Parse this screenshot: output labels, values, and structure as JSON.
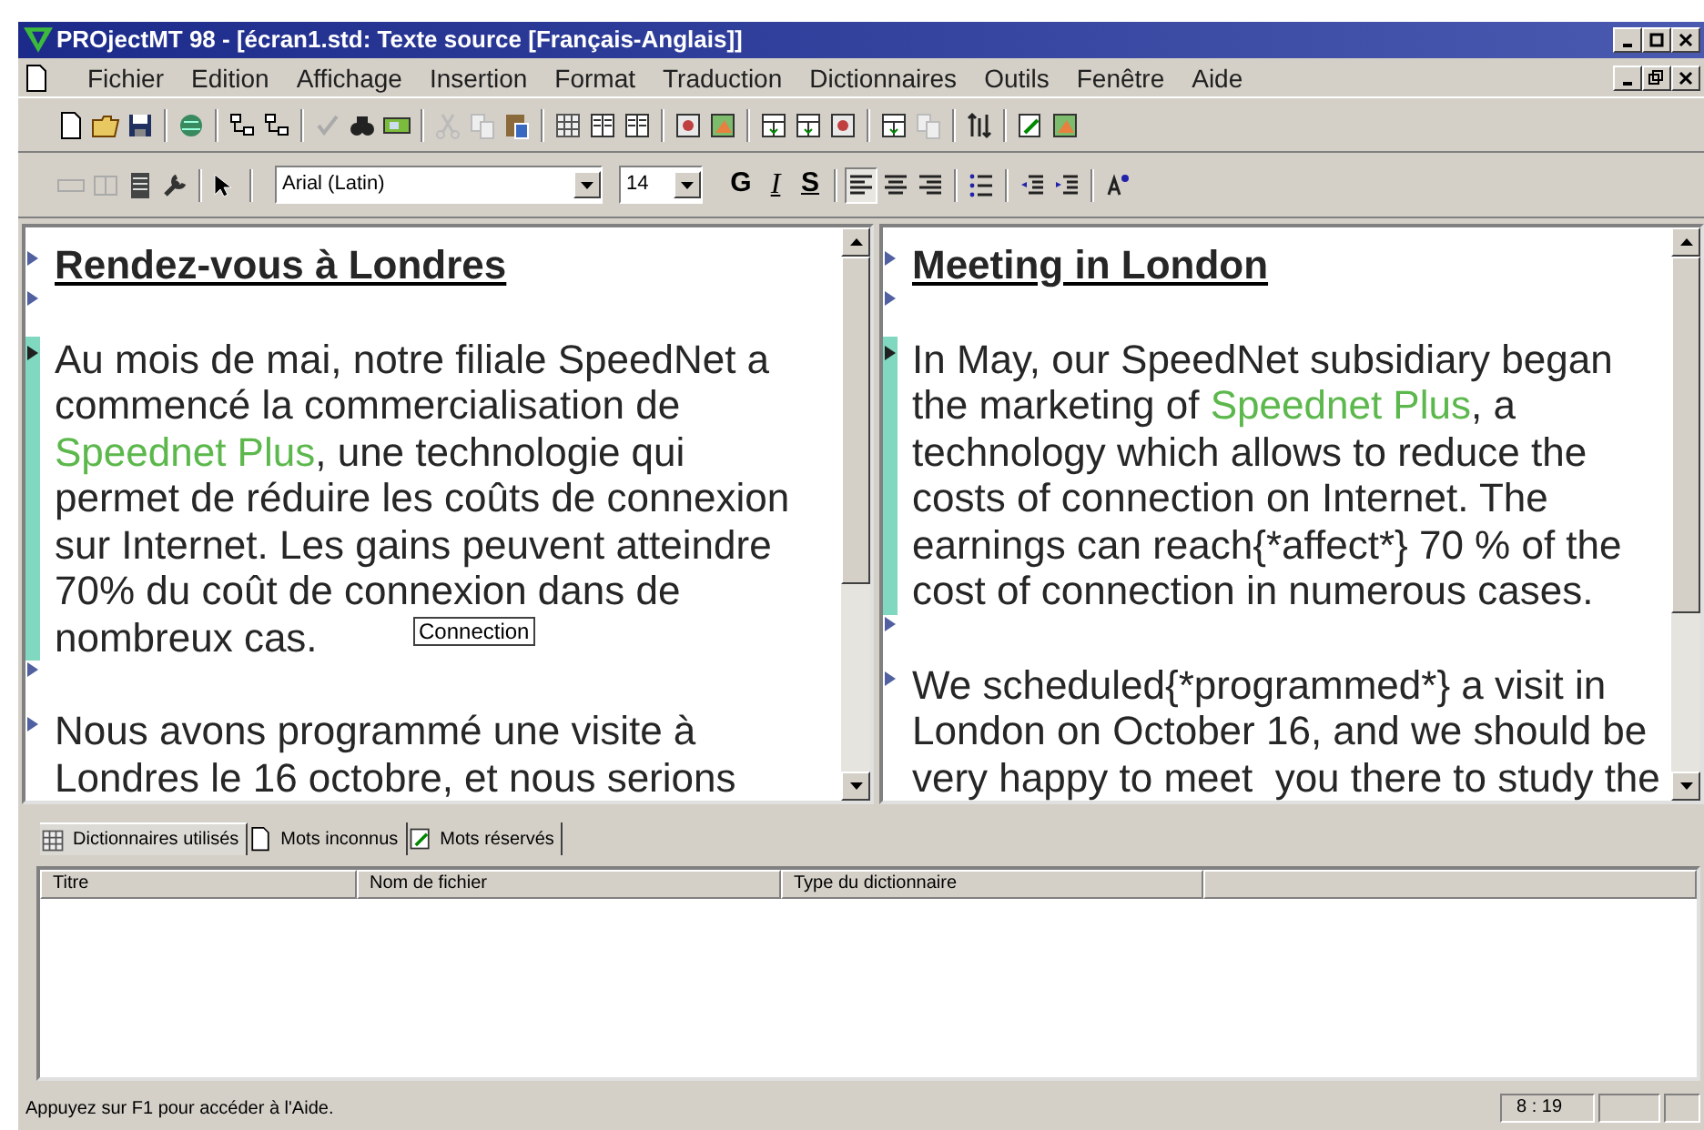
{
  "window": {
    "title": "PROjectMT 98 - [écran1.std: Texte source [Français-Anglais]]"
  },
  "menu": [
    "Fichier",
    "Edition",
    "Affichage",
    "Insertion",
    "Format",
    "Traduction",
    "Dictionnaires",
    "Outils",
    "Fenêtre",
    "Aide"
  ],
  "format_bar": {
    "font": "Arial (Latin)",
    "size": "14",
    "bold_label": "G",
    "italic_label": "I",
    "underline_label": "S"
  },
  "panes": [
    {
      "paragraphs": [
        {
          "kind": "heading",
          "selected": false,
          "lines": [
            [
              {
                "text": "Rendez-vous à Londres",
                "kind": "plain"
              }
            ]
          ]
        },
        {
          "kind": "empty",
          "selected": false
        },
        {
          "kind": "body",
          "selected": true,
          "lines": [
            [
              {
                "text": "Au mois de mai, notre filiale SpeedNet a",
                "kind": "plain"
              }
            ],
            [
              {
                "text": "commencé la commercialisation de",
                "kind": "plain"
              }
            ],
            [
              {
                "text": "Speednet Plus",
                "kind": "term"
              },
              {
                "text": ", une technologie qui",
                "kind": "plain"
              }
            ],
            [
              {
                "text": "permet de réduire les coûts de connexion",
                "kind": "plain"
              }
            ],
            [
              {
                "text": "sur Internet. Les gains peuvent atteindre",
                "kind": "plain"
              }
            ],
            [
              {
                "text": "70% du coût de connexion dans de",
                "kind": "plain"
              }
            ],
            [
              {
                "text": "nombreux cas.",
                "kind": "plain"
              }
            ]
          ]
        },
        {
          "kind": "empty",
          "selected": false
        },
        {
          "kind": "body",
          "selected": false,
          "lines": [
            [
              {
                "text": "Nous avons programmé une visite à",
                "kind": "plain"
              }
            ],
            [
              {
                "text": "Londres le 16 octobre, et nous serions",
                "kind": "plain"
              }
            ]
          ]
        }
      ],
      "tooltip": "Connection"
    },
    {
      "paragraphs": [
        {
          "kind": "heading",
          "selected": false,
          "lines": [
            [
              {
                "text": "Meeting in London",
                "kind": "plain"
              }
            ]
          ]
        },
        {
          "kind": "empty",
          "selected": false
        },
        {
          "kind": "body",
          "selected": true,
          "lines": [
            [
              {
                "text": "In May, our SpeedNet subsidiary began",
                "kind": "plain"
              }
            ],
            [
              {
                "text": "the marketing of ",
                "kind": "plain"
              },
              {
                "text": "Speednet Plus",
                "kind": "term"
              },
              {
                "text": ", a",
                "kind": "plain"
              }
            ],
            [
              {
                "text": "technology which allows to reduce the",
                "kind": "plain"
              }
            ],
            [
              {
                "text": "costs of connection on Internet. The",
                "kind": "plain"
              }
            ],
            [
              {
                "text": "earnings can reach{*affect*} 70 % of the",
                "kind": "plain"
              }
            ],
            [
              {
                "text": "cost of connection in numerous cases.",
                "kind": "plain"
              }
            ]
          ]
        },
        {
          "kind": "empty",
          "selected": false
        },
        {
          "kind": "body",
          "selected": false,
          "lines": [
            [
              {
                "text": "We scheduled{*programmed*} a visit in",
                "kind": "plain"
              }
            ],
            [
              {
                "text": "London on October 16, and we should be",
                "kind": "plain"
              }
            ],
            [
              {
                "text": "very happy to meet  you there to study the",
                "kind": "plain"
              }
            ]
          ]
        }
      ]
    }
  ],
  "bottom_tabs": [
    {
      "label": "Dictionnaires utilisés",
      "selected": true
    },
    {
      "label": "Mots inconnus",
      "selected": false
    },
    {
      "label": "Mots réservés",
      "selected": false
    }
  ],
  "table": {
    "columns": [
      "Titre",
      "Nom de fichier",
      "Type du dictionnaire"
    ]
  },
  "status_bar": {
    "message": "Appuyez sur F1 pour accéder à l'Aide.",
    "position": "8 : 19"
  }
}
